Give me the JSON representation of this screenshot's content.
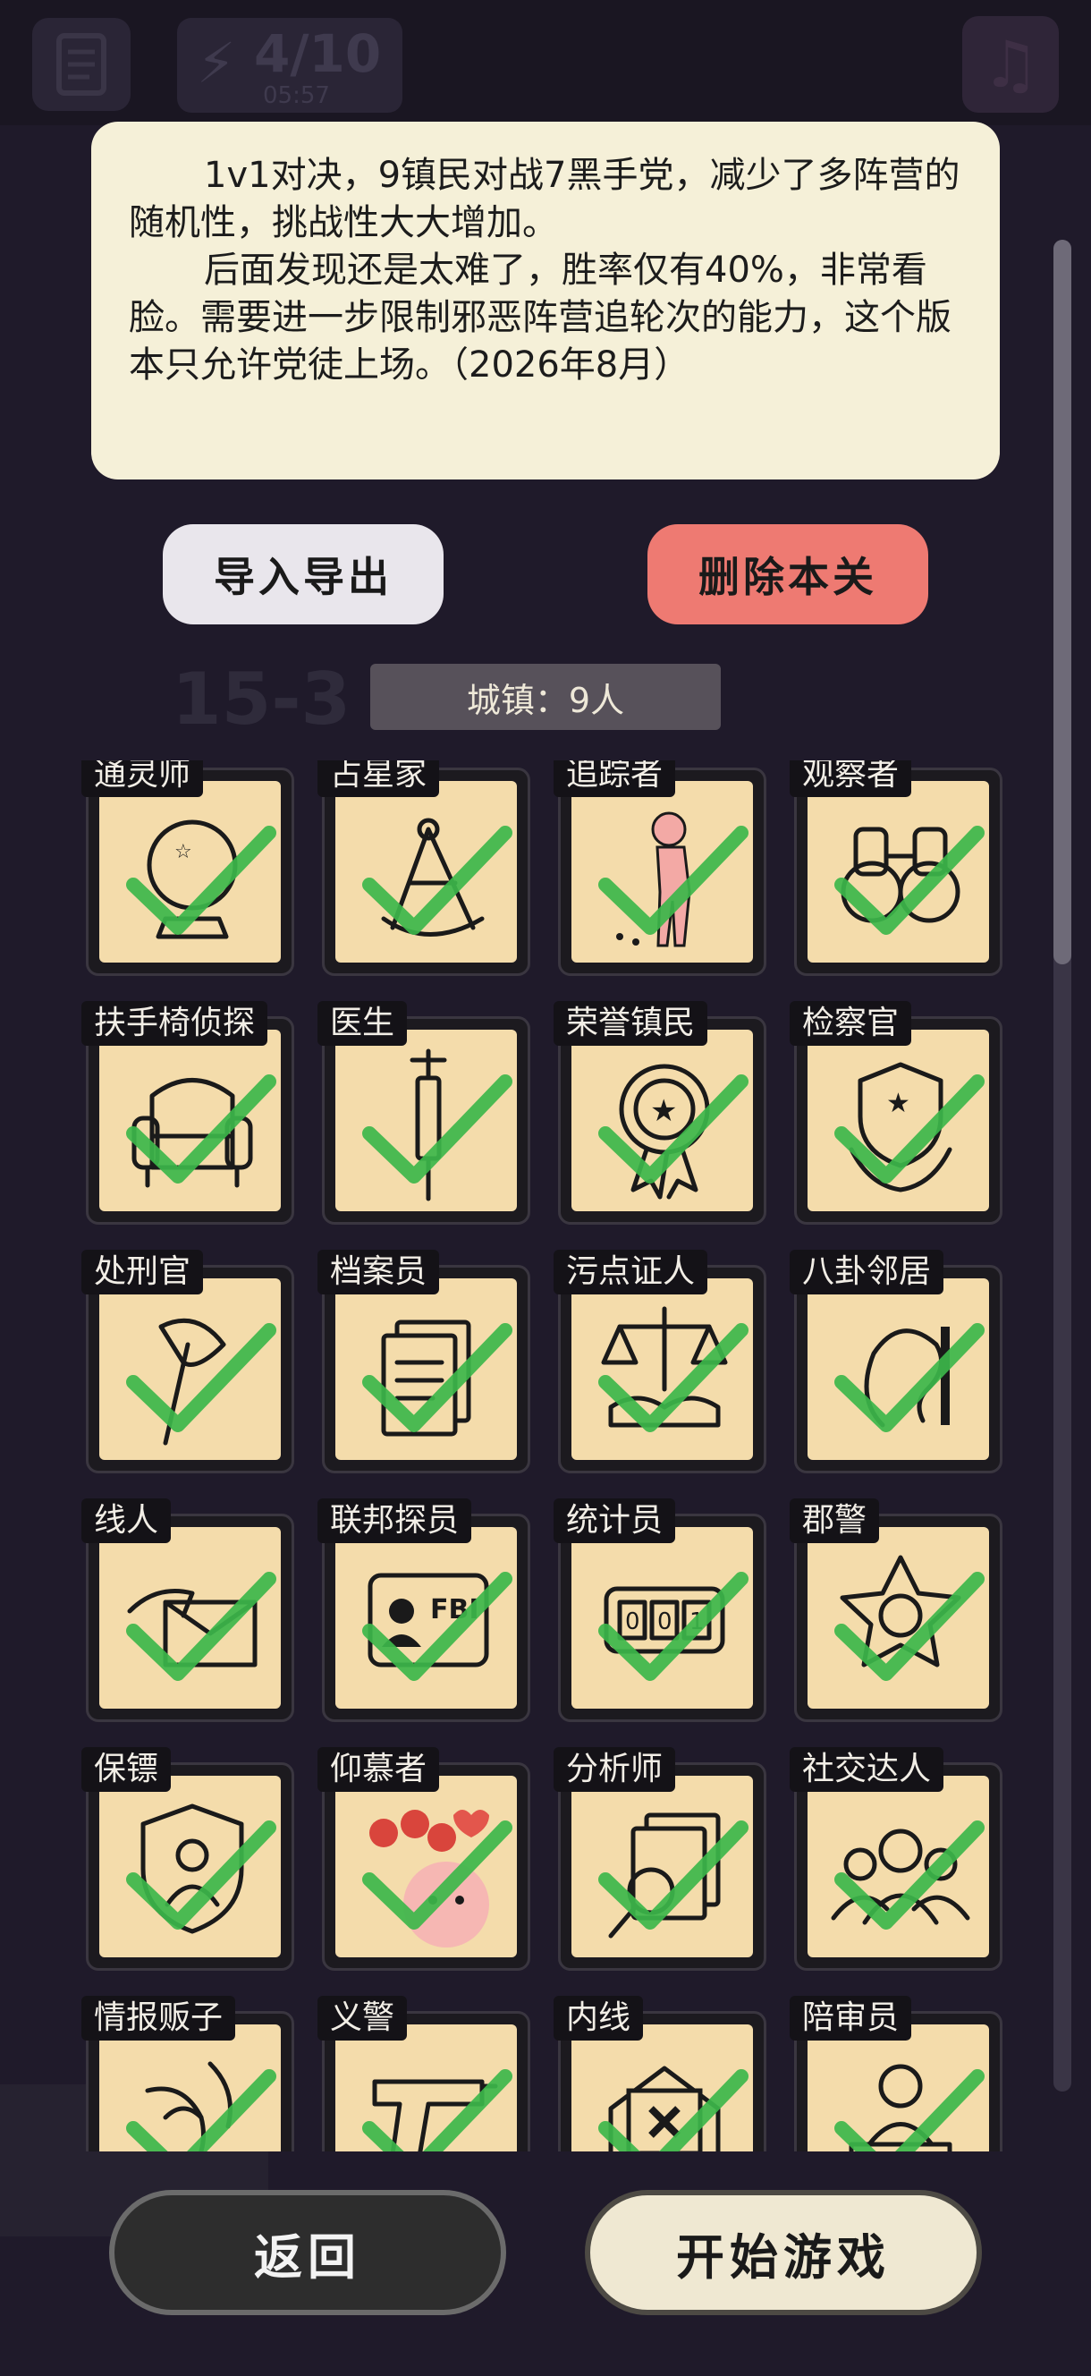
{
  "hud": {
    "energy": "4/10",
    "timer": "05:57"
  },
  "background": {
    "level_code": "15-3"
  },
  "intro": {
    "paragraphs": [
      "1v1对决，9镇民对战7黑手党，减少了多阵营的随机性，挑战性大大增加。",
      "后面发现还是太难了，胜率仅有40%，非常看脸。需要进一步限制邪恶阵营追轮次的能力，这个版本只允许党徒上场。（2026年8月）"
    ]
  },
  "buttons": {
    "import_export": "导入导出",
    "delete_level": "删除本关",
    "back": "返回",
    "start_game": "开始游戏"
  },
  "town_count": "城镇：9人",
  "colors": {
    "card_bg": "#f4dcab",
    "check": "#3cb64a",
    "delete": "#ee7a72"
  },
  "roles": [
    {
      "label": "通灵师",
      "icon": "crystal-ball-icon",
      "selected": true
    },
    {
      "label": "占星家",
      "icon": "sextant-icon",
      "selected": true
    },
    {
      "label": "追踪者",
      "icon": "tracker-figure-icon",
      "selected": true
    },
    {
      "label": "观察者",
      "icon": "binoculars-icon",
      "selected": true
    },
    {
      "label": "扶手椅侦探",
      "icon": "armchair-icon",
      "selected": true
    },
    {
      "label": "医生",
      "icon": "syringe-icon",
      "selected": true
    },
    {
      "label": "荣誉镇民",
      "icon": "medal-icon",
      "selected": true
    },
    {
      "label": "检察官",
      "icon": "prosecutor-badge-icon",
      "selected": true
    },
    {
      "label": "处刑官",
      "icon": "axe-icon",
      "selected": true
    },
    {
      "label": "档案员",
      "icon": "documents-icon",
      "selected": true
    },
    {
      "label": "污点证人",
      "icon": "scales-handshake-icon",
      "selected": true
    },
    {
      "label": "八卦邻居",
      "icon": "ear-icon",
      "selected": true
    },
    {
      "label": "线人",
      "icon": "envelope-hand-icon",
      "selected": true
    },
    {
      "label": "联邦探员",
      "icon": "fbi-badge-icon",
      "selected": true
    },
    {
      "label": "统计员",
      "icon": "counter-icon",
      "selected": true
    },
    {
      "label": "郡警",
      "icon": "sheriff-star-icon",
      "selected": true
    },
    {
      "label": "保镖",
      "icon": "bodyguard-shield-icon",
      "selected": true
    },
    {
      "label": "仰慕者",
      "icon": "admirer-roses-icon",
      "selected": true
    },
    {
      "label": "分析师",
      "icon": "magnifier-papers-icon",
      "selected": true
    },
    {
      "label": "社交达人",
      "icon": "crowd-icon",
      "selected": true
    },
    {
      "label": "情报贩子",
      "icon": "whisper-icon",
      "selected": true
    },
    {
      "label": "义警",
      "icon": "pistol-icon",
      "selected": true
    },
    {
      "label": "内线",
      "icon": "x-envelope-icon",
      "selected": true
    },
    {
      "label": "陪审员",
      "icon": "juror-icon",
      "selected": true
    }
  ]
}
